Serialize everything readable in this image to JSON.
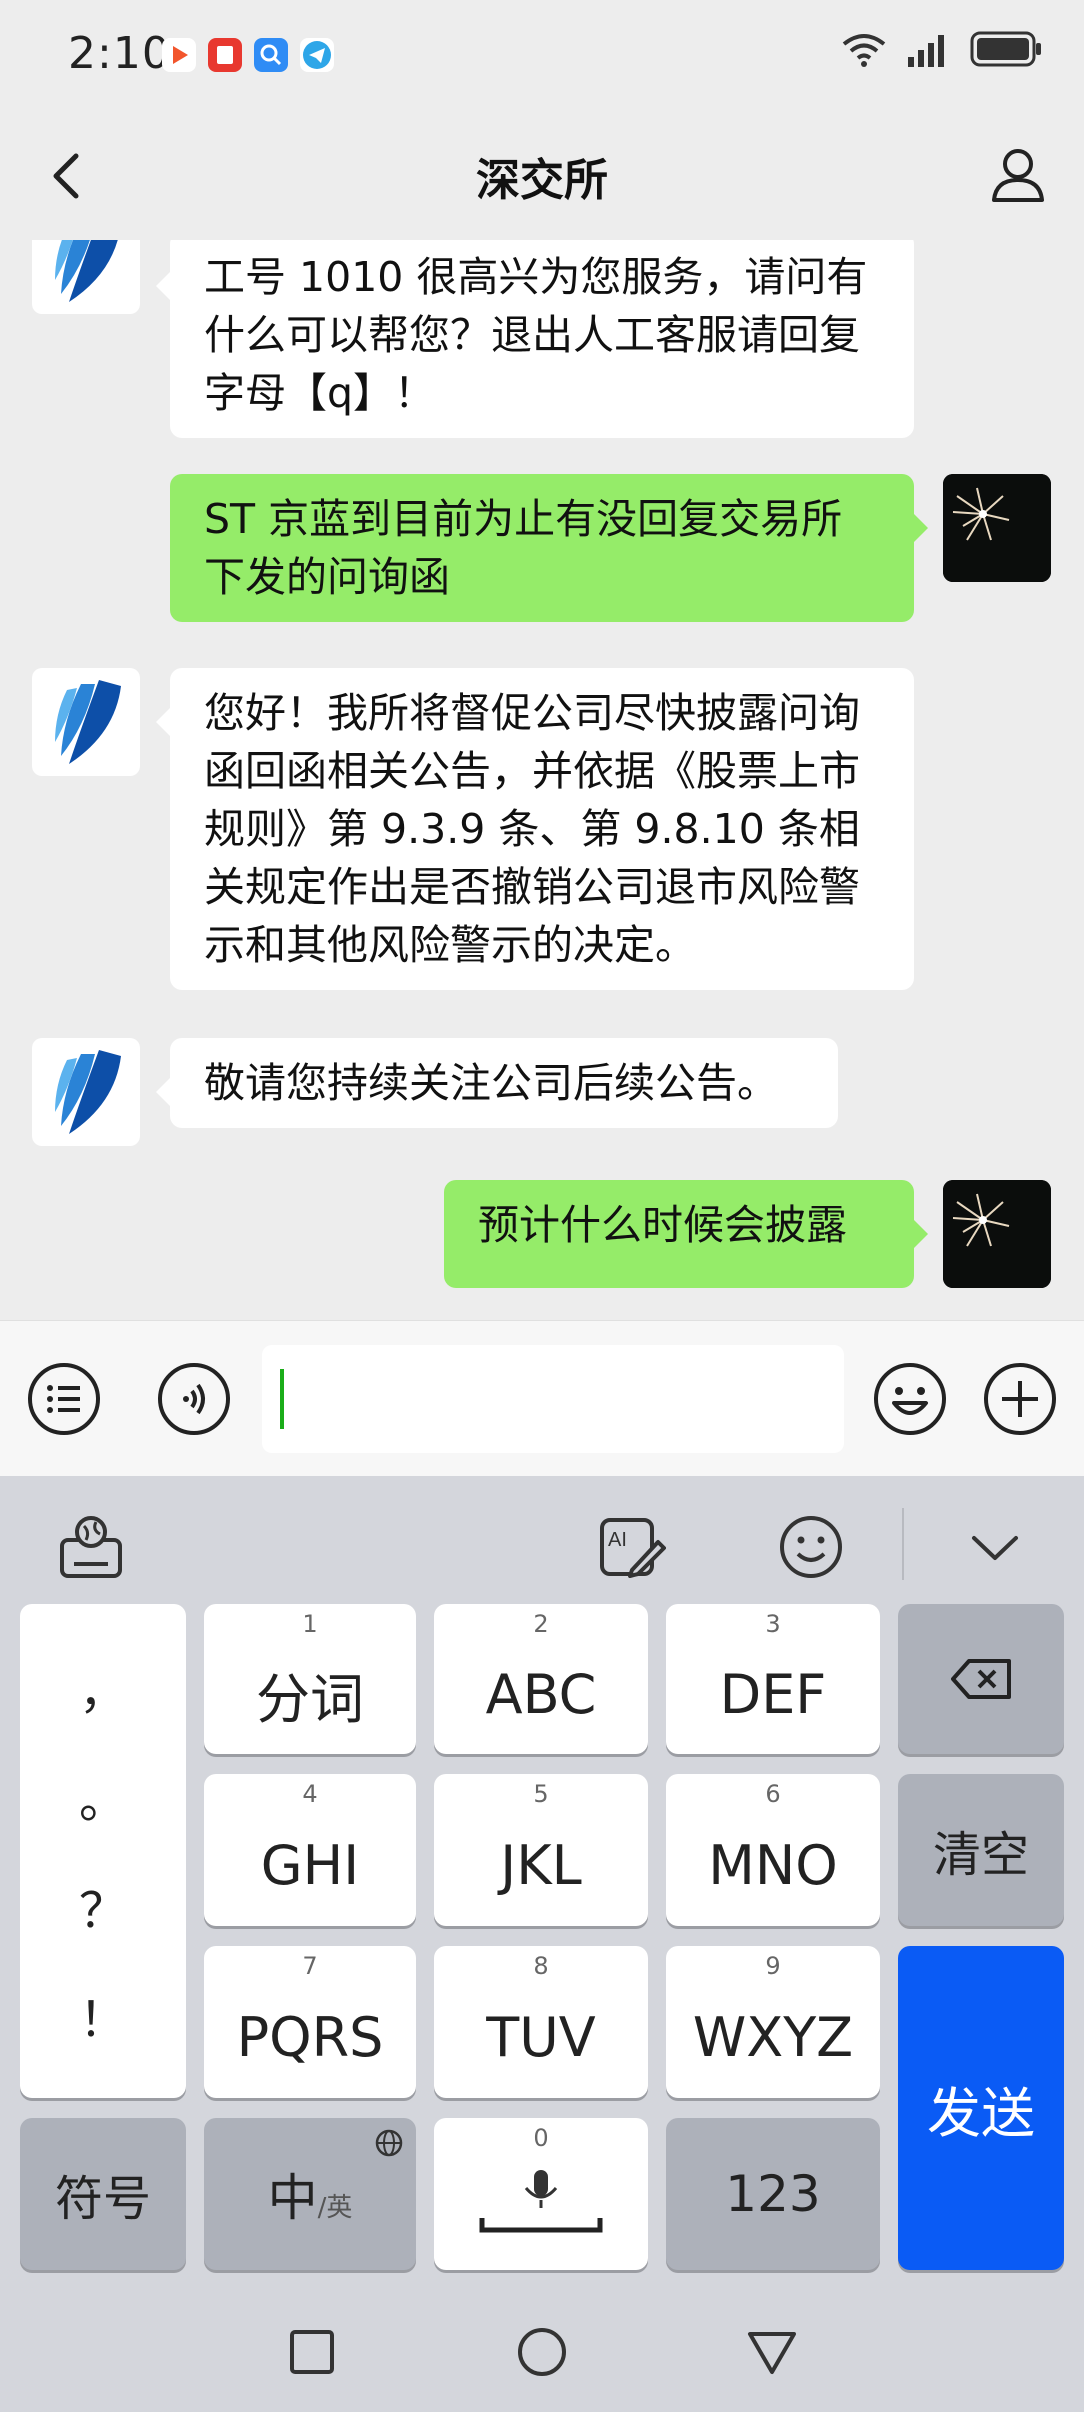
{
  "status_bar": {
    "time": "2:10",
    "app_icons": [
      "video-app-icon",
      "news-app-icon",
      "search-app-icon",
      "telegram-app-icon"
    ],
    "icons": [
      "wifi-icon",
      "signal-icon",
      "battery-icon"
    ]
  },
  "header": {
    "title": "深交所"
  },
  "messages": [
    {
      "from": "other",
      "text": "工号 1010 很高兴为您服务，请问有什么可以帮您？退出人工客服请回复字母【q】！"
    },
    {
      "from": "me",
      "text": "ST 京蓝到目前为止有没回复交易所下发的问询函"
    },
    {
      "from": "other",
      "text": "您好！我所将督促公司尽快披露问询函回函相关公告，并依据《股票上市规则》第 9.3.9 条、第 9.8.10 条相关规定作出是否撤销公司退市风险警示和其他风险警示的决定。"
    },
    {
      "from": "other",
      "text": "敬请您持续关注公司后续公告。"
    },
    {
      "from": "me",
      "text": "预计什么时候会披露"
    }
  ],
  "input": {
    "value": ""
  },
  "keyboard": {
    "punctuation": [
      "，",
      "。",
      "？",
      "！"
    ],
    "keys": [
      {
        "num": "1",
        "label": "分词"
      },
      {
        "num": "2",
        "label": "ABC"
      },
      {
        "num": "3",
        "label": "DEF"
      },
      {
        "num": "4",
        "label": "GHI"
      },
      {
        "num": "5",
        "label": "JKL"
      },
      {
        "num": "6",
        "label": "MNO"
      },
      {
        "num": "7",
        "label": "PQRS"
      },
      {
        "num": "8",
        "label": "TUV"
      },
      {
        "num": "9",
        "label": "WXYZ"
      }
    ],
    "clear": "清空",
    "send": "发送",
    "symbols": "符号",
    "lang_main": "中",
    "lang_sub": "/英",
    "space_num": "0",
    "numbers": "123",
    "accent_color": "#0a5bf5",
    "bubble_out_color": "#95ec69"
  }
}
